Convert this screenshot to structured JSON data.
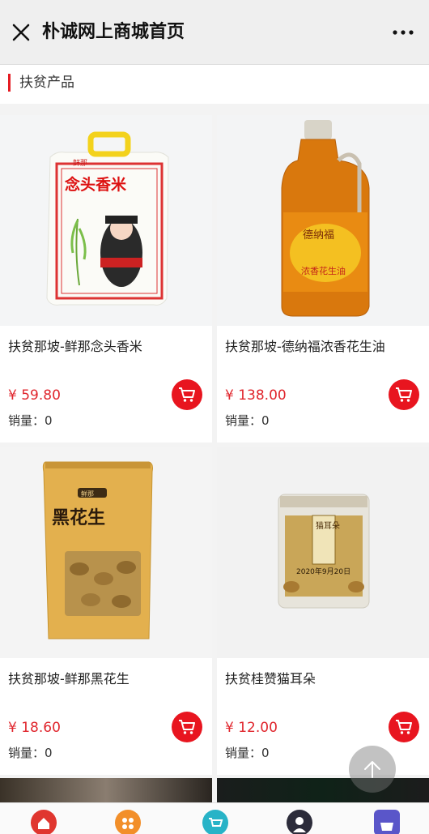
{
  "header": {
    "title": "朴诚网上商城首页"
  },
  "section": {
    "title": "扶贫产品"
  },
  "products": [
    {
      "name": "扶贫那坡-鲜那念头香米",
      "price": "¥ 59.80",
      "sales": "销量：0"
    },
    {
      "name": "扶贫那坡-德纳福浓香花生油",
      "price": "¥ 138.00",
      "sales": "销量：0"
    },
    {
      "name": "扶贫那坡-鲜那黑花生",
      "price": "¥ 18.60",
      "sales": "销量：0"
    },
    {
      "name": "扶贫桂赞猫耳朵",
      "price": "¥ 12.00",
      "sales": "销量：0"
    }
  ],
  "product_images": {
    "rice": {
      "brand": "鲜那",
      "title": "念头香米"
    },
    "oil": {
      "brand": "德纳福",
      "title": "浓香花生油"
    },
    "peanut": {
      "brand": "鲜那",
      "title": "黑花生"
    },
    "cookie": {
      "title": "猫耳朵",
      "date": "2020年9月20日"
    }
  },
  "colors": {
    "accent": "#e8151f",
    "price": "#e0262d"
  },
  "tabs": [
    "home-icon",
    "category-icon",
    "cart-icon",
    "user-icon",
    "basket-icon"
  ]
}
